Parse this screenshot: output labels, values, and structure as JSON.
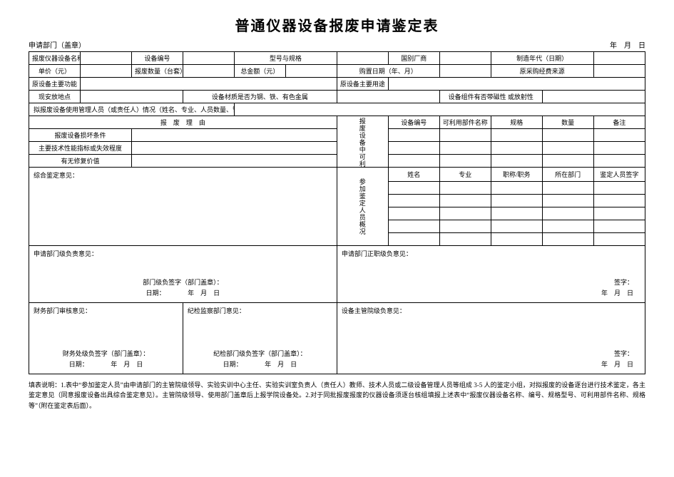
{
  "title": "普通仪器设备报废申请鉴定表",
  "header": {
    "dept": "申请部门（盖章）",
    "date": "年　月　日"
  },
  "row1": {
    "c1": "报废仪器设备名称",
    "c2": "设备编号",
    "c3": "型号与规格",
    "c4": "国别厂商",
    "c5": "制造年代（日期）"
  },
  "row2": {
    "c1": "单价（元）",
    "c2": "报废数量（台套）",
    "c3": "总金额（元）",
    "c4": "购置日期（年、月）",
    "c5": "原采购经费来源"
  },
  "row3": {
    "c1": "原设备主要功能",
    "c2": "原设备主要用途"
  },
  "row4": {
    "c1": "现安放地点",
    "c2": "设备材质是否为钢、铁、有色金属",
    "c3": "设备组件有否带磁性 或放射性"
  },
  "row5": "拟报废设备使用管理人员（或责任人）情况（姓名、专业、人员数量、管理时间等）",
  "row6_left": {
    "header": "报　废　理　由",
    "r1": "报废设备损坏条件",
    "r2": "主要技术性能指标或失效程度",
    "r3": "有无修复价值"
  },
  "row6_mid_v": "报废设备中可利用部件",
  "row6_mid_h": {
    "h1": "设备编号",
    "h2": "可利用部件名称",
    "h3": "规格",
    "h4": "数量",
    "h5": "备注"
  },
  "row7": {
    "left": "综合鉴定意见：",
    "mid_v": "参加鉴定人员概况",
    "h1": "姓名",
    "h2": "专业",
    "h3": "职称/职务",
    "h4": "所在部门",
    "h5": "鉴定人员签字"
  },
  "sig": {
    "b1_title": "申请部门级负责意见：",
    "b1_line1": "部门级负签字（部门盖章）：",
    "b1_date": "日期：　　　　年　月　日",
    "b2_title": "申请部门正职级负意见：",
    "b2_sign": "签字：",
    "b2_date": "年　月　日",
    "b3_title": "财务部门审核意见：",
    "b3_line1": "财务处级负签字（部门盖章）：",
    "b3_date": "日期：　　　　年　月　日",
    "b4_title": "纪检监察部门意见：",
    "b4_line1": "纪检部门级负签字（部门盖章）：",
    "b4_date": "日期：　　　　年　月　日",
    "b5_title": "设备主管院级负意见：",
    "b5_sign": "签字：",
    "b5_date": "年　月　日"
  },
  "notes": "填表说明：1.表中“参加鉴定人员”由申请部门的主管院级领导、实验实训中心主任、实验实训室负责人（责任人）教师、技术人员或二级设备管理人员等组成 3-5 人的鉴定小组，对拟报废的设备逐台进行技术鉴定，各主鉴定意见（同意报废设备出具综合鉴定意见）。主管院级领导、使用部门盖章后上报学院设备处。2.对于同批报废报废的仪器设备须逐台核组填报上述表中“报废仪器设备名称、编号、规格型号、可利用部件名称、规格等”（附在鉴定表后面）。"
}
